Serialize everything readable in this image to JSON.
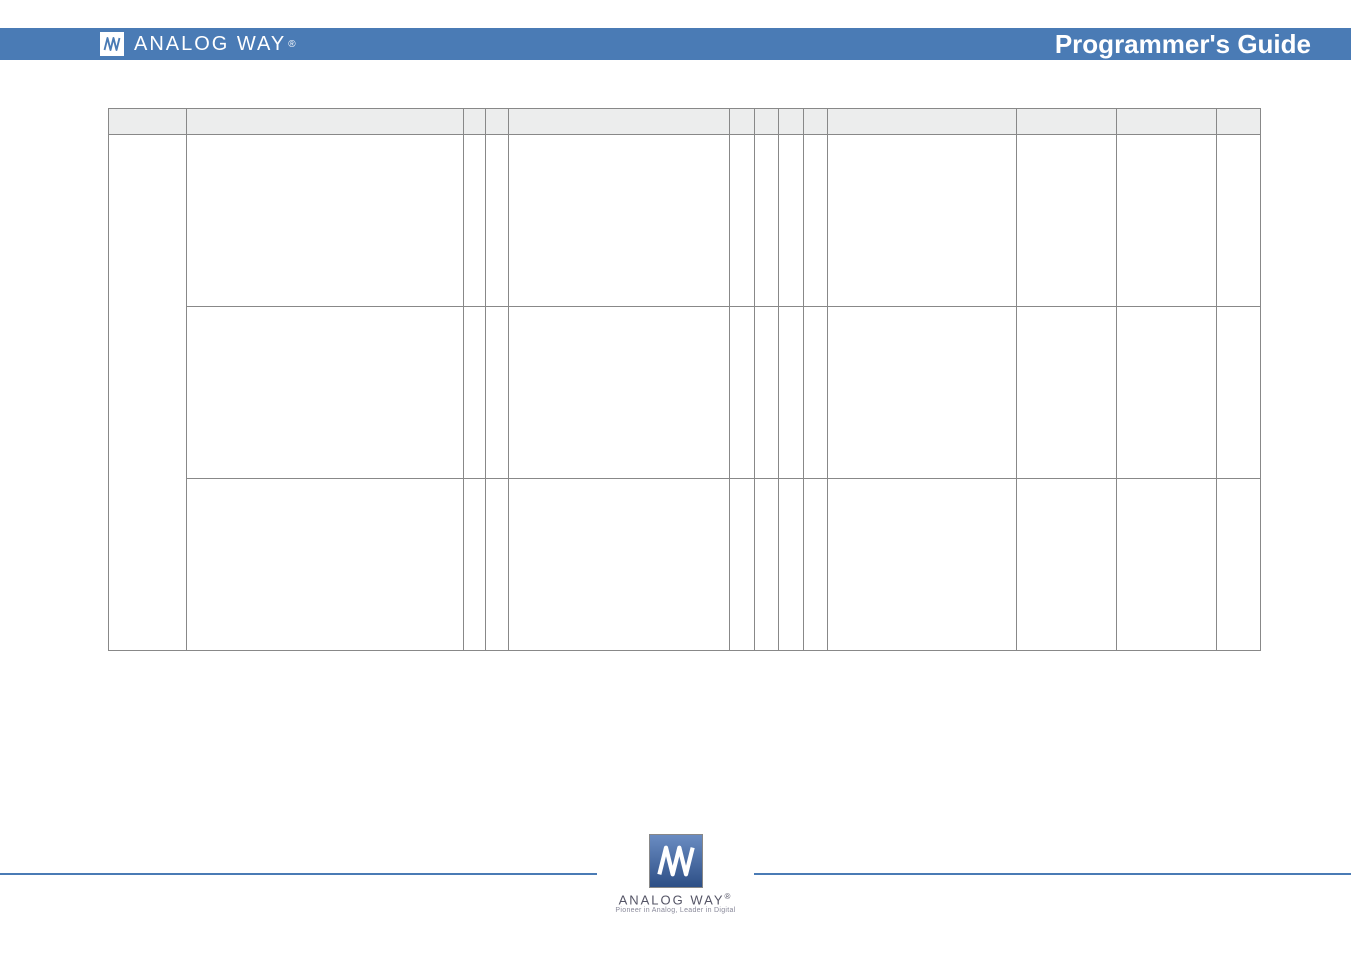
{
  "header": {
    "brand": "ANALOG WAY",
    "reg": "®",
    "title": "Programmer's Guide"
  },
  "footer": {
    "brand": "ANALOG WAY",
    "reg": "®",
    "tagline": "Pioneer in Analog, Leader in Digital"
  },
  "table": {
    "headers": [
      "",
      "",
      "",
      "",
      "",
      "",
      "",
      "",
      "",
      "",
      "",
      "",
      ""
    ],
    "rows": [
      {
        "group": "",
        "cells": [
          "",
          "",
          "",
          "",
          "",
          "",
          "",
          "",
          "",
          "",
          "",
          ""
        ]
      },
      {
        "group_continued": true,
        "cells": [
          "",
          "",
          "",
          "",
          "",
          "",
          "",
          "",
          "",
          "",
          "",
          ""
        ]
      },
      {
        "group_continued": true,
        "cells": [
          "",
          "",
          "",
          "",
          "",
          "",
          "",
          "",
          "",
          "",
          "",
          ""
        ]
      }
    ]
  }
}
